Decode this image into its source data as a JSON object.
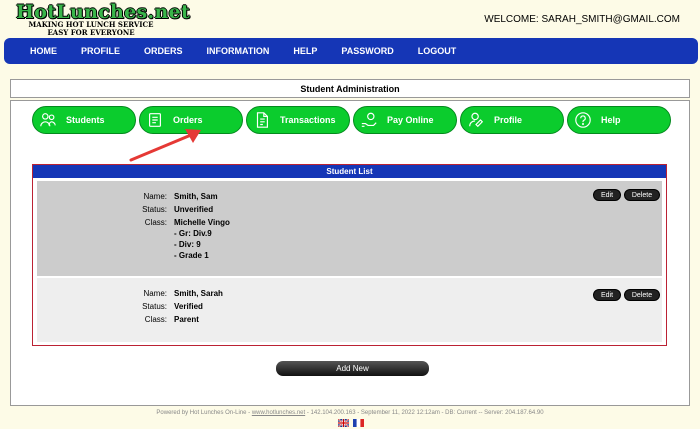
{
  "logo": {
    "title": "HotLunches.net",
    "tagline_1": "MAKING HOT LUNCH SERVICE",
    "tagline_2": "EASY FOR EVERYONE"
  },
  "welcome": "WELCOME: SARAH_SMITH@GMAIL.COM",
  "nav": [
    "HOME",
    "PROFILE",
    "ORDERS",
    "INFORMATION",
    "HELP",
    "PASSWORD",
    "LOGOUT"
  ],
  "panel_title": "Student Administration",
  "tabs": [
    {
      "label": "Students",
      "icon": "students-icon"
    },
    {
      "label": "Orders",
      "icon": "orders-icon"
    },
    {
      "label": "Transactions",
      "icon": "transactions-icon"
    },
    {
      "label": "Pay Online",
      "icon": "pay-online-icon"
    },
    {
      "label": "Profile",
      "icon": "profile-icon"
    },
    {
      "label": "Help",
      "icon": "help-icon"
    }
  ],
  "student_list": {
    "title": "Student List",
    "labels": {
      "name": "Name:",
      "status": "Status:",
      "class": "Class:"
    },
    "students": [
      {
        "name": "Smith, Sam",
        "status": "Unverified",
        "class_lines": [
          "Michelle Vingo",
          "- Gr: Div.9",
          "- Div: 9",
          "- Grade 1"
        ]
      },
      {
        "name": "Smith, Sarah",
        "status": "Verified",
        "class_lines": [
          "Parent"
        ]
      }
    ],
    "edit_label": "Edit",
    "delete_label": "Delete"
  },
  "add_new_label": "Add New",
  "footer": {
    "prefix": "Powered by Hot Lunches On-Line - ",
    "link": "www.hotlunches.net",
    "suffix": " - 142.104.200.163 - September 11, 2022 12:12am - DB: Current -- Server: 204.187.64.90"
  },
  "colors": {
    "nav_bg": "#1536b6",
    "tab_green": "#0bcc2d",
    "page_bg": "#fdfbe7",
    "arrow": "#e53935"
  }
}
